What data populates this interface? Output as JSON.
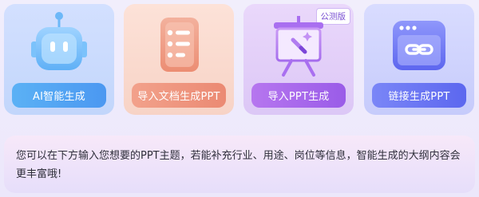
{
  "cards": [
    {
      "label": "AI智能生成",
      "icon": "robot-icon"
    },
    {
      "label": "导入文档生成PPT",
      "icon": "document-icon"
    },
    {
      "label": "导入PPT生成",
      "icon": "presentation-board-icon",
      "badge": "公测版"
    },
    {
      "label": "链接生成PPT",
      "icon": "link-window-icon"
    }
  ],
  "hint": {
    "text": "您可以在下方输入您想要的PPT主题，若能补充行业、用途、岗位等信息，智能生成的大纲内容会更丰富哦!"
  },
  "colors": {
    "ai_button": "#4b98f1",
    "doc_button": "#eb8a73",
    "ppt_button": "#9a5ce8",
    "link_button": "#5c67ef"
  }
}
